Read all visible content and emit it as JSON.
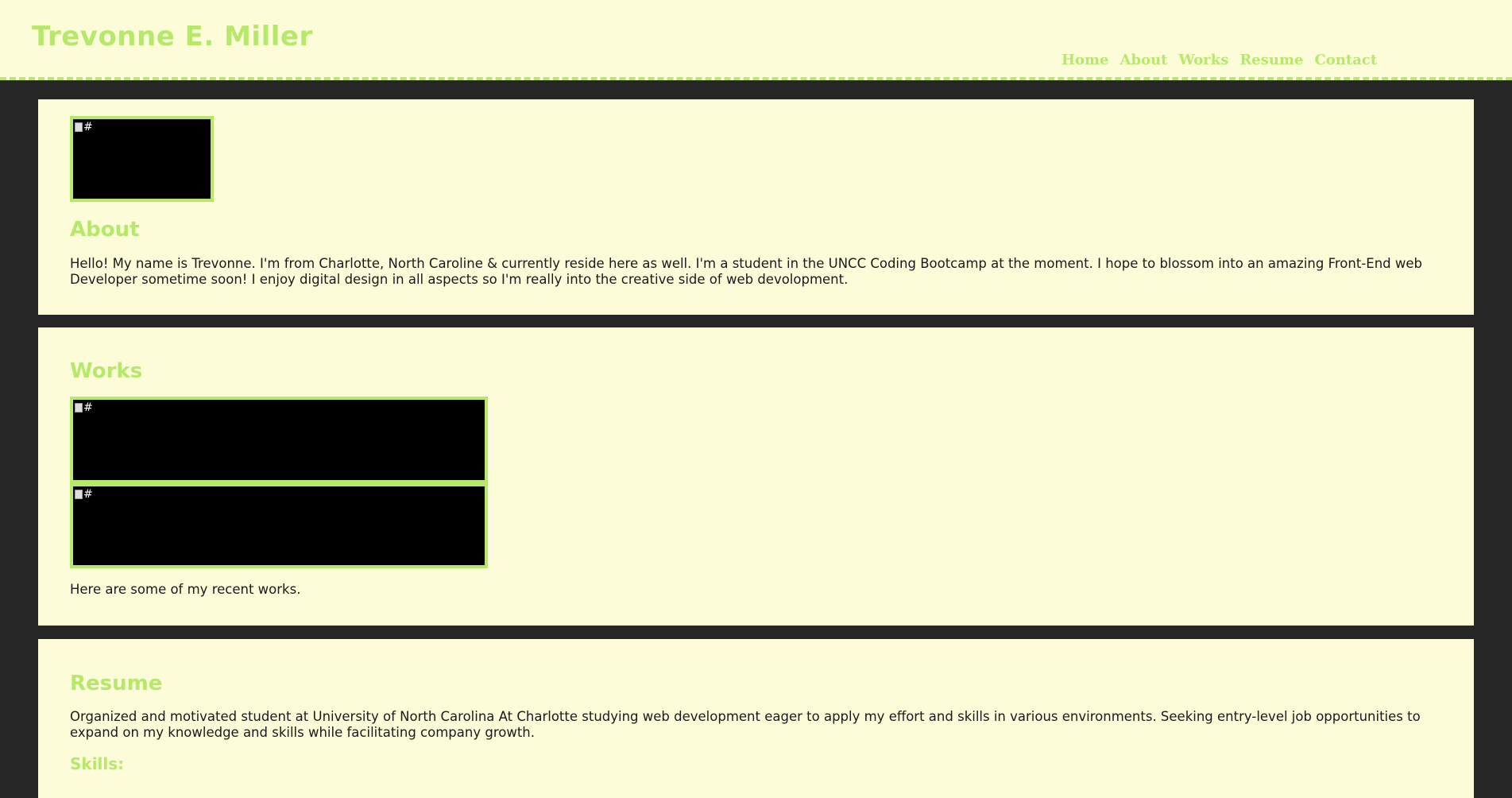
{
  "header": {
    "title": "Trevonne E. Miller",
    "nav": [
      "Home",
      "About",
      "Works",
      "Resume",
      "Contact"
    ]
  },
  "about": {
    "image_alt": "#",
    "heading": "About",
    "text": "Hello! My name is Trevonne. I'm from Charlotte, North Caroline & currently reside here as well. I'm a student in the UNCC Coding Bootcamp at the moment. I hope to blossom into an amazing Front-End web Developer sometime soon! I enjoy digital design in all aspects so I'm really into the creative side of web devolopment."
  },
  "works": {
    "heading": "Works",
    "images": [
      "#",
      "#"
    ],
    "caption": "Here are some of my recent works."
  },
  "resume": {
    "heading": "Resume",
    "text": "Organized and motivated student at University of North Carolina At Charlotte studying web development eager to apply my effort and skills in various environments. Seeking entry-level job opportunities to expand on my knowledge and skills while facilitating company growth.",
    "skills_heading": "Skills:"
  },
  "colors": {
    "accent": "#b6e96b",
    "panel": "#fcfcd9",
    "page_bg": "#262626",
    "text": "#1a1a1a"
  }
}
